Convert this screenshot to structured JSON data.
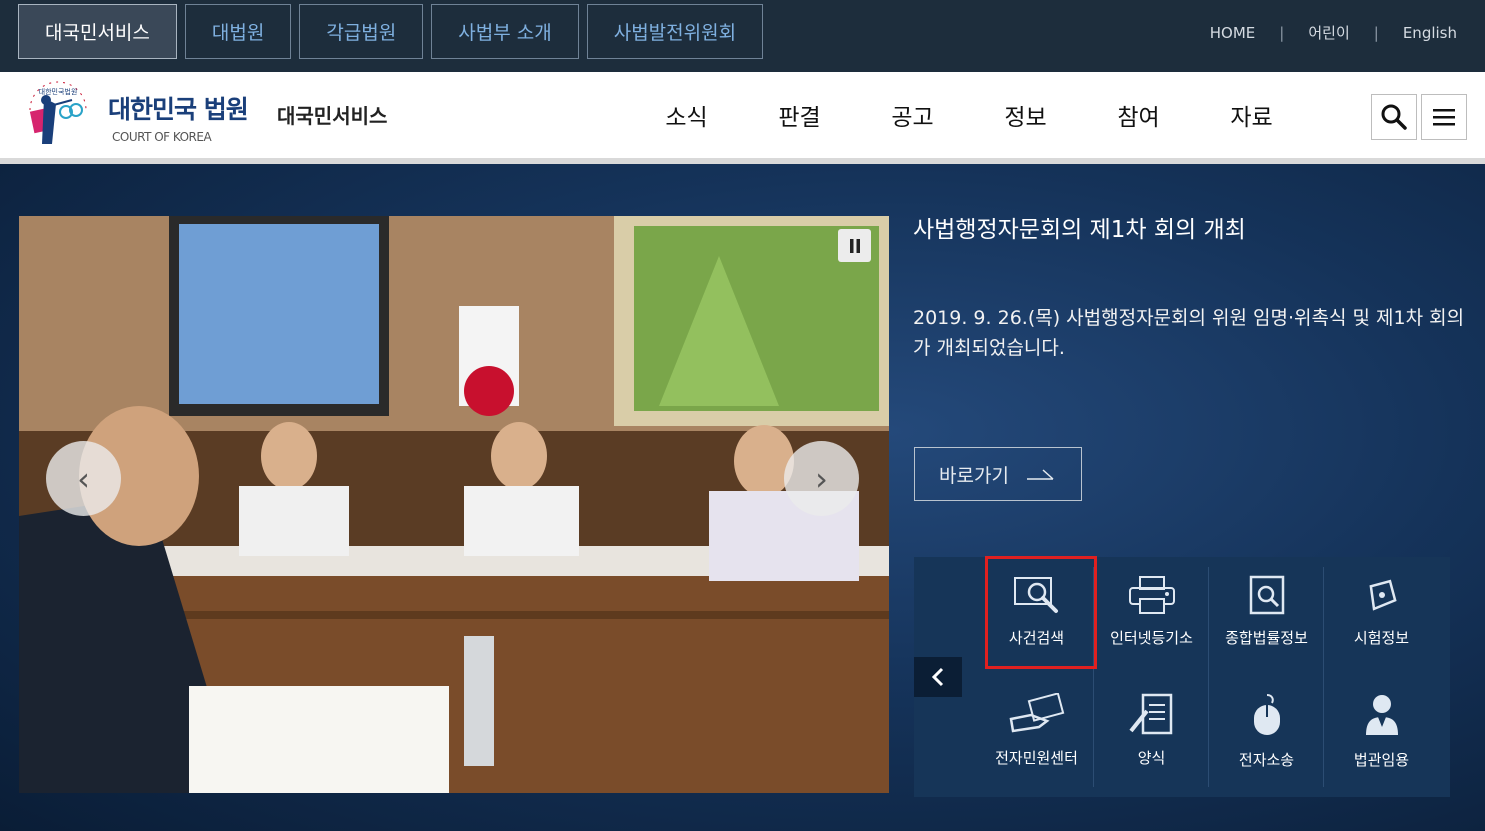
{
  "top_tabs": [
    "대국민서비스",
    "대법원",
    "각급법원",
    "사법부 소개",
    "사법발전위원회"
  ],
  "top_links": {
    "home": "HOME",
    "kids": "어린이",
    "english": "English",
    "separator": "|"
  },
  "header": {
    "logo_arc_text": "대한민국법원",
    "brand": "대한민국 법원",
    "brand_sub": "COURT OF KOREA",
    "service": "대국민서비스",
    "nav": [
      "소식",
      "판결",
      "공고",
      "정보",
      "참여",
      "자료"
    ]
  },
  "icons": {
    "search": "search-icon",
    "menu": "hamburger-menu-icon",
    "pause": "pause-icon",
    "prev": "chevron-left-icon",
    "next": "chevron-right-icon",
    "arrow": "arrow-right-icon"
  },
  "slider": {
    "title": "사법행정자문회의 제1차 회의 개최",
    "description": "2019. 9. 26.(목) 사법행정자문회의 위원 임명·위촉식 및 제1차 회의가 개최되었습니다.",
    "goto_label": "바로가기",
    "prev_symbol": "‹",
    "next_symbol": "›"
  },
  "quick_menu": [
    {
      "label": "사건검색",
      "icon": "case-search-icon"
    },
    {
      "label": "인터넷등기소",
      "icon": "printer-icon"
    },
    {
      "label": "종합법률정보",
      "icon": "legal-info-search-icon"
    },
    {
      "label": "시험정보",
      "icon": "pen-nib-icon"
    },
    {
      "label": "전자민원센터",
      "icon": "hand-envelope-icon"
    },
    {
      "label": "양식",
      "icon": "form-document-icon"
    },
    {
      "label": "전자소송",
      "icon": "mouse-icon"
    },
    {
      "label": "법관임용",
      "icon": "judge-person-icon"
    }
  ],
  "colors": {
    "topbar": "#1d2d3c",
    "brand": "#1a3f7a",
    "hero": "#15335a",
    "quick_bg": "#163558",
    "highlight": "#e02020"
  }
}
